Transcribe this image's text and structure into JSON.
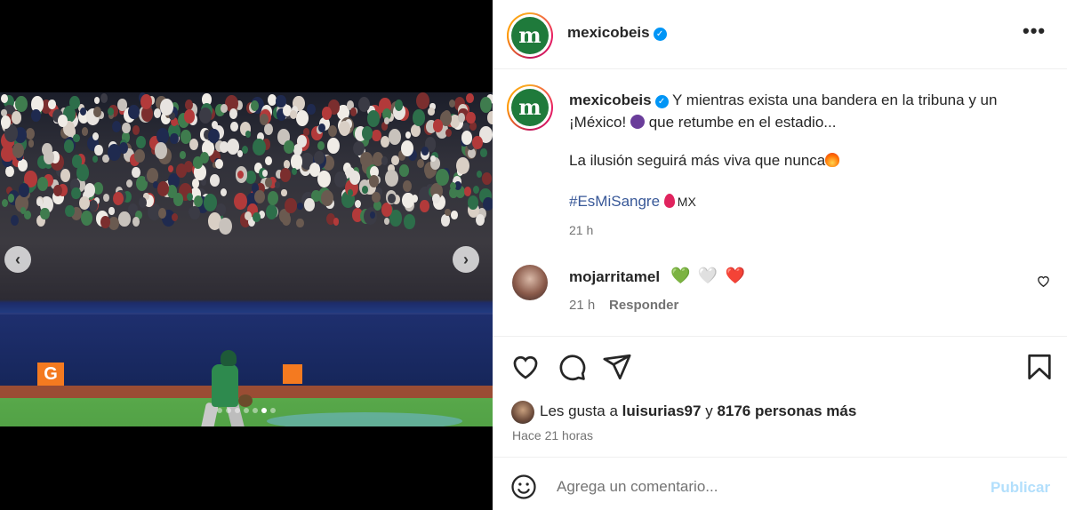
{
  "post": {
    "username": "mexicobeis",
    "avatar_logo_text": "m",
    "verified": true
  },
  "caption": {
    "username": "mexicobeis",
    "line1": "Y mientras exista una bandera en la tribuna y un ¡México!",
    "line1b": "que retumbe en el estadio...",
    "line2": "La ilusión seguirá más viva que nunca",
    "hashtag": "#EsMiSangre",
    "hashtag_suffix": "MX",
    "time": "21 h"
  },
  "comment": {
    "username": "mojarritamel",
    "hearts": [
      "💚",
      "🤍",
      "❤️"
    ],
    "time": "21 h",
    "reply_label": "Responder"
  },
  "likes": {
    "prefix": "Les gusta a",
    "user": "luisurias97",
    "connector": "y",
    "others": "8176 personas más"
  },
  "post_date": "Hace 21 horas",
  "comment_bar": {
    "placeholder": "Agrega un comentario...",
    "publish_label": "Publicar"
  },
  "carousel": {
    "total": 7,
    "active_index": 5
  },
  "icons": {
    "more": "more-options-icon",
    "like": "heart-icon",
    "comment": "comment-icon",
    "share": "share-icon",
    "save": "bookmark-icon",
    "emoji": "emoji-icon",
    "prev": "chevron-left-icon",
    "next": "chevron-right-icon"
  },
  "colors": {
    "verified": "#0095f6",
    "hashtag": "#385898",
    "publish": "#b2dffc",
    "secondary_text": "#737373"
  }
}
